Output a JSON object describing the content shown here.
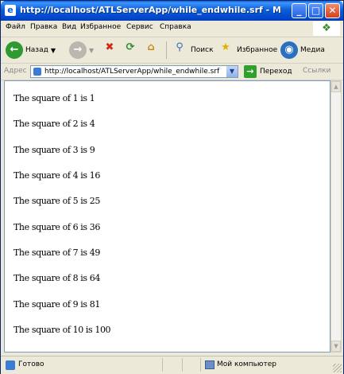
{
  "window": {
    "title": "http://localhost/ATLServerApp/while_endwhile.srf - Microsoft Internet Explorer"
  },
  "menu": [
    "Файл",
    "Правка",
    "Вид",
    "Избранное",
    "Сервис",
    "Справка"
  ],
  "toolbar": {
    "back_label": "Назад",
    "search_label": "Поиск",
    "favorites_label": "Избранное",
    "media_label": "Медиа"
  },
  "address": {
    "label": "Адрес",
    "url": "http://localhost/ATLServerApp/while_endwhile.srf",
    "go_label": "Переход",
    "links_label": "Ссылки"
  },
  "content": {
    "lines": [
      "The square of 1 is 1",
      "The square of 2 is 4",
      "The square of 3 is 9",
      "The square of 4 is 16",
      "The square of 5 is 25",
      "The square of 6 is 36",
      "The square of 7 is 49",
      "The square of 8 is 64",
      "The square of 9 is 81",
      "The square of 10 is 100"
    ]
  },
  "status": {
    "text": "Готово",
    "zone": "Мой компьютер"
  },
  "colors": {
    "titlebar": "#0a5fd8",
    "window_bg": "#ece9d8",
    "close_button": "#d4411e"
  }
}
